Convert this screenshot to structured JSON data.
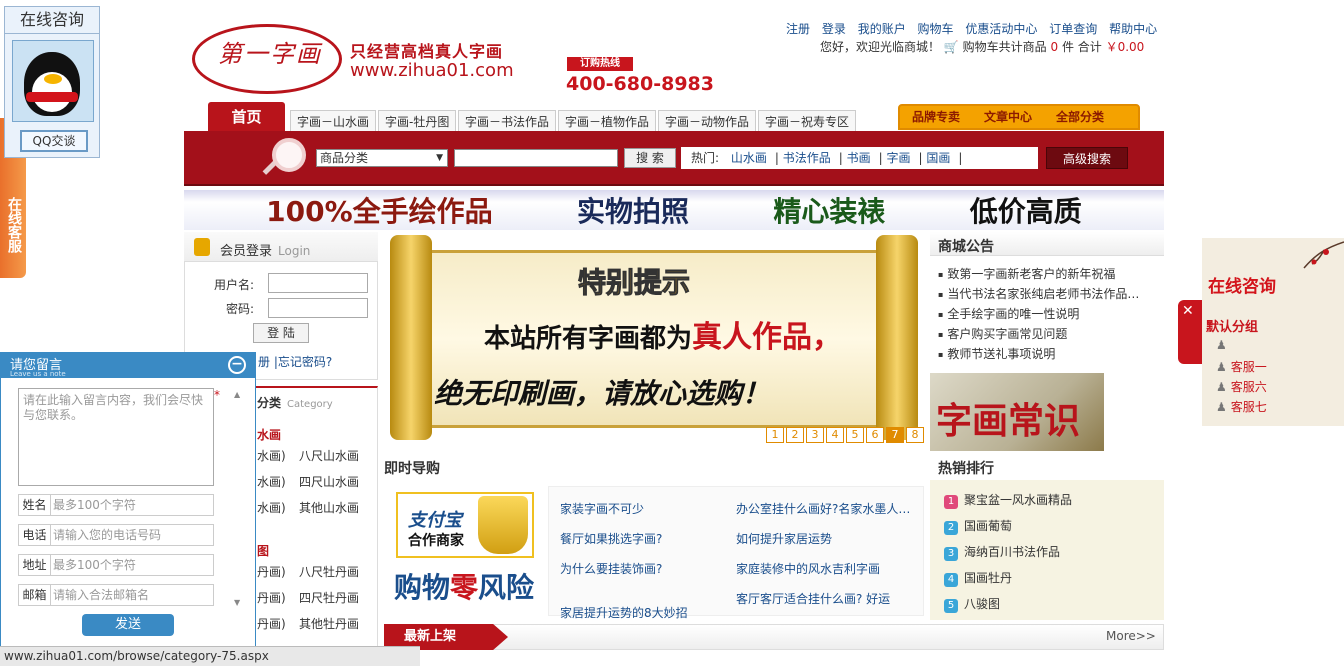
{
  "header": {
    "logo_text": "第一字画",
    "slogan": "只经营高档真人字画",
    "url": "www.zihua01.com",
    "hotline_label": "订购热线",
    "hotline": "400-680-8983",
    "top_links": [
      "注册",
      "登录",
      "我的账户",
      "购物车",
      "优惠活动中心",
      "订单查询",
      "帮助中心"
    ],
    "welcome": "您好，欢迎光临商城！",
    "cart_text": "购物车共计商品",
    "cart_count": "0",
    "cart_unit": "件 合计",
    "cart_total": "￥0.00"
  },
  "nav": {
    "home": "首页",
    "tabs": [
      "字画－山水画",
      "字画-牡丹图",
      "字画－书法作品",
      "字画－植物作品",
      "字画－动物作品",
      "字画－祝寿专区"
    ],
    "right": [
      "品牌专卖",
      "文章中心",
      "全部分类"
    ]
  },
  "search": {
    "category": "商品分类",
    "button": "搜 索",
    "hot_label": "热门:",
    "hot": [
      "山水画",
      "书法作品",
      "书画",
      "字画",
      "国画"
    ],
    "advanced": "高级搜索"
  },
  "banner": [
    "100%全手绘作品",
    "实物拍照",
    "精心装裱",
    "低价高质"
  ],
  "login": {
    "title": "会员登录",
    "title_en": "Login",
    "user_label": "用户名:",
    "pass_label": "密码:",
    "button": "登 陆",
    "links": "册 |忘记密码?"
  },
  "categories": {
    "title": "分类",
    "title_en": "Category",
    "groups": [
      {
        "head": "水画",
        "rows": [
          [
            "水画)",
            "八尺山水画"
          ],
          [
            "水画)",
            "四尺山水画"
          ],
          [
            "水画)",
            "其他山水画"
          ]
        ]
      },
      {
        "head": "图",
        "rows": [
          [
            "丹画)",
            "八尺牡丹画"
          ],
          [
            "丹画)",
            "四尺牡丹画"
          ],
          [
            "丹画)",
            "其他牡丹画"
          ]
        ]
      }
    ]
  },
  "slide": {
    "title": "特别提示",
    "line1": "本站所有字画都为",
    "line1_em": "真人作品，",
    "line2": "绝无印刷画，请放心选购！",
    "pages": [
      "1",
      "2",
      "3",
      "4",
      "5",
      "6",
      "7",
      "8"
    ],
    "active_page": 7
  },
  "notice": {
    "title": "商城公告",
    "items": [
      "致第一字画新老客户的新年祝福",
      "当代书法名家张纯启老师书法作品…",
      "全手绘字画的唯一性说明",
      "客户购买字画常见问题",
      "教师节送礼事项说明"
    ],
    "zhishi": "字画常识"
  },
  "guide": {
    "title": "即时导购",
    "alipay_1": "支付宝",
    "alipay_2": "合作商家",
    "alipay_risk_a": "购物",
    "alipay_risk_b": "零",
    "alipay_risk_c": "风险",
    "left": [
      "家装字画不可少",
      "餐厅如果挑选字画?",
      "为什么要挂装饰画?",
      "家居提升运势的8大妙招"
    ],
    "right": [
      "办公室挂什么画好?名家水墨人…",
      "如何提升家居运势",
      "家庭装修中的风水吉利字画",
      "客厅客厅适合挂什么画? 好运"
    ]
  },
  "hot": {
    "title": "热销排行",
    "items": [
      "聚宝盆一风水画精品",
      "国画葡萄",
      "海纳百川书法作品",
      "国画牡丹",
      "八骏图"
    ],
    "colors": [
      "#e0497a",
      "#3aa6d8",
      "#3aa6d8",
      "#3aa6d8",
      "#3aa6d8"
    ]
  },
  "newest": {
    "title": "最新上架",
    "more": "More>>"
  },
  "qq": {
    "title": "在线咨询",
    "button": "QQ交谈",
    "tab": "在线客服"
  },
  "message": {
    "title": "请您留言",
    "subtitle": "Leave us a note",
    "placeholder": "请在此输入留言内容，我们会尽快与您联系。",
    "fields": [
      {
        "label": "姓名",
        "placeholder": "最多100个字符"
      },
      {
        "label": "电话",
        "placeholder": "请输入您的电话号码"
      },
      {
        "label": "地址",
        "placeholder": "最多100个字符"
      },
      {
        "label": "邮箱",
        "placeholder": "请输入合法邮箱名"
      }
    ],
    "send": "发送"
  },
  "status_url": "www.zihua01.com/browse/category-75.aspx",
  "right_consult": {
    "title": "在线咨询",
    "group": "默认分组",
    "items": [
      "",
      "客服一",
      "客服六",
      "客服七"
    ]
  }
}
